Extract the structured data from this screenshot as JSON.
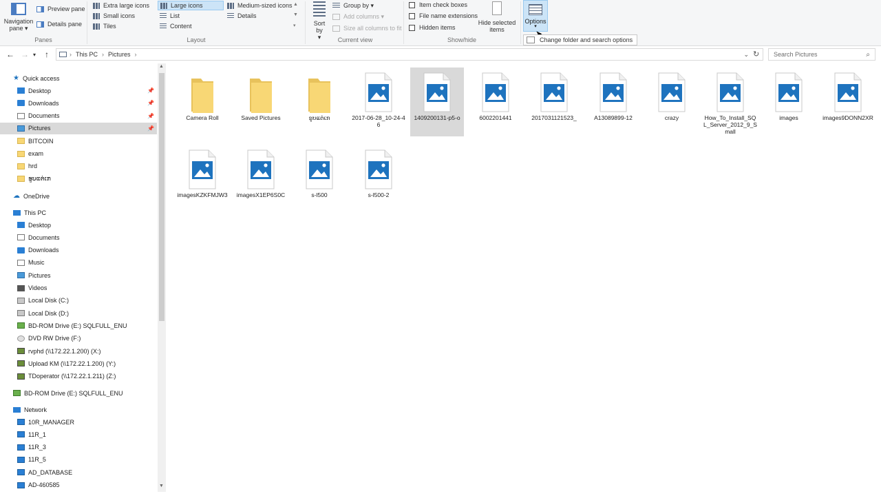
{
  "ribbon": {
    "panes": {
      "navigation_pane": "Navigation pane",
      "preview_pane": "Preview pane",
      "details_pane": "Details pane",
      "group_label": "Panes"
    },
    "layout": {
      "items": [
        "Extra large icons",
        "Large icons",
        "Medium-sized icons",
        "Small icons",
        "List",
        "Details",
        "Tiles",
        "Content"
      ],
      "selected": "Large icons",
      "group_label": "Layout"
    },
    "current_view": {
      "sort_by": "Sort by",
      "group_by": "Group by",
      "add_columns": "Add columns",
      "size_columns": "Size all columns to fit",
      "group_label": "Current view"
    },
    "show_hide": {
      "item_check_boxes": "Item check boxes",
      "file_name_extensions": "File name extensions",
      "hidden_items": "Hidden items",
      "hide_selected": "Hide selected items",
      "group_label": "Show/hide"
    },
    "options": "Options",
    "tooltip": "Change folder and search options"
  },
  "address": {
    "crumbs": [
      "This PC",
      "Pictures"
    ],
    "search_placeholder": "Search Pictures"
  },
  "sidebar": {
    "quick_access": "Quick access",
    "quick_items": [
      "Desktop",
      "Downloads",
      "Documents",
      "Pictures",
      "BITCOIN",
      "exam",
      "hrd",
      "ຮູບແຕ່ເກ"
    ],
    "onedrive": "OneDrive",
    "this_pc": "This PC",
    "pc_items": [
      "Desktop",
      "Documents",
      "Downloads",
      "Music",
      "Pictures",
      "Videos",
      "Local Disk (C:)",
      "Local Disk (D:)",
      "BD-ROM Drive (E:) SQLFULL_ENU",
      "DVD RW Drive (F:)",
      "rvphd (\\\\172.22.1.200) (X:)",
      "Upload KM (\\\\172.22.1.200) (Y:)",
      "TDoperator (\\\\172.22.1.211) (Z:)"
    ],
    "bd_rom": "BD-ROM Drive (E:) SQLFULL_ENU",
    "network": "Network",
    "network_items": [
      "10R_MANAGER",
      "11R_1",
      "11R_3",
      "11R_5",
      "AD_DATABASE",
      "AD-460585"
    ]
  },
  "files": [
    {
      "name": "Camera Roll",
      "type": "folder"
    },
    {
      "name": "Saved Pictures",
      "type": "folder"
    },
    {
      "name": "ຮູບແຕ່ເກ",
      "type": "folder"
    },
    {
      "name": "2017-06-28_10-24-46",
      "type": "image"
    },
    {
      "name": "1409200131-p5-o",
      "type": "image"
    },
    {
      "name": "6002201441",
      "type": "image"
    },
    {
      "name": "2017031121523_",
      "type": "image"
    },
    {
      "name": "A13089899-12",
      "type": "image"
    },
    {
      "name": "crazy",
      "type": "image"
    },
    {
      "name": "How_To_Install_SQL_Server_2012_9_Small",
      "type": "image"
    },
    {
      "name": "images",
      "type": "image"
    },
    {
      "name": "images9DONN2XR",
      "type": "image"
    },
    {
      "name": "imagesKZKFMJW3",
      "type": "image"
    },
    {
      "name": "imagesX1EP6S0C",
      "type": "image"
    },
    {
      "name": "s-l500",
      "type": "image"
    },
    {
      "name": "s-l500-2",
      "type": "image"
    }
  ],
  "selected_file_index": 4,
  "colors": {
    "accent": "#0078d7",
    "folder": "#f8d775",
    "image_blue": "#1e73be",
    "selection": "#cce4f7"
  }
}
